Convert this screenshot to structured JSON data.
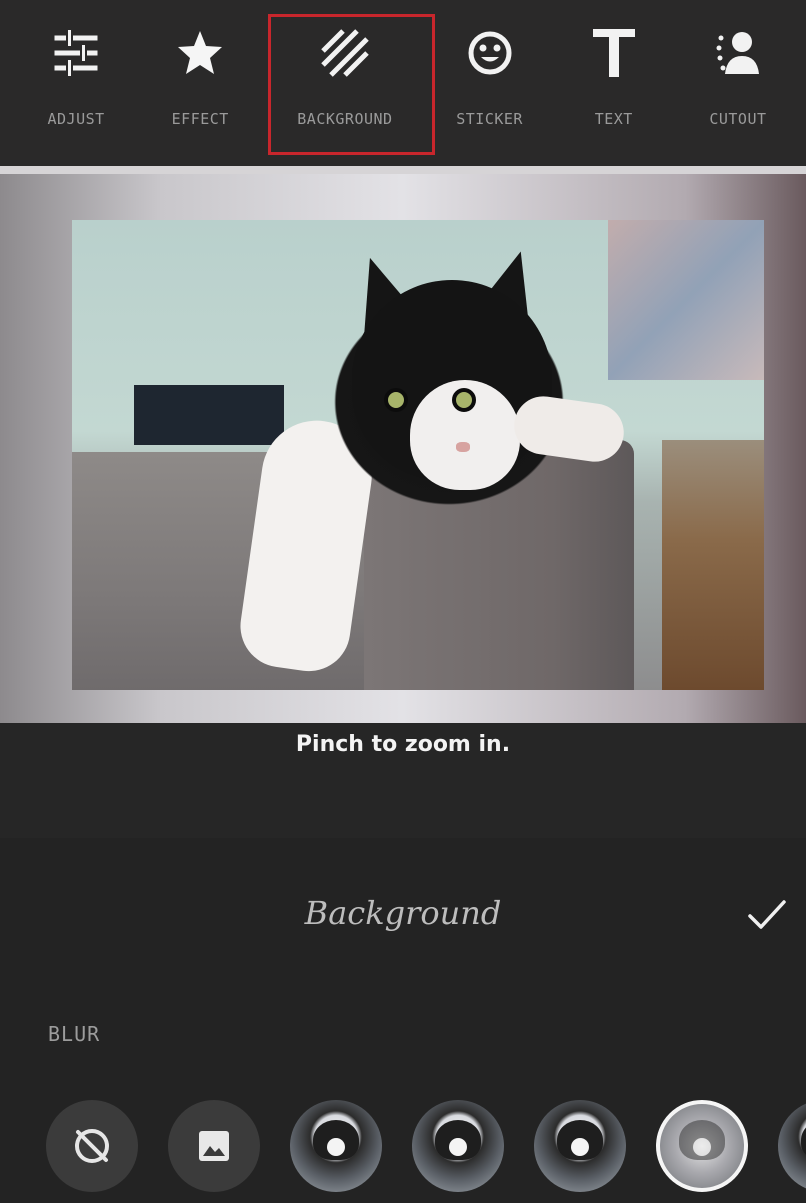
{
  "toolbar": {
    "items": [
      {
        "label": "ADJUST",
        "icon": "sliders-icon"
      },
      {
        "label": "EFFECT",
        "icon": "star-icon"
      },
      {
        "label": "BACKGROUND",
        "icon": "diagonal-stripes-icon",
        "selected": true
      },
      {
        "label": "STICKER",
        "icon": "smiley-icon"
      },
      {
        "label": "TEXT",
        "icon": "text-icon"
      },
      {
        "label": "CUTOUT",
        "icon": "person-cutout-icon"
      }
    ],
    "highlight_color": "#c8262c"
  },
  "canvas": {
    "hint": "Pinch to zoom in."
  },
  "panel": {
    "title": "Background",
    "section_label": "BLUR",
    "options": [
      {
        "kind": "none",
        "icon": "no-blur-icon"
      },
      {
        "kind": "gallery",
        "icon": "image-icon"
      },
      {
        "kind": "thumbnail"
      },
      {
        "kind": "thumbnail"
      },
      {
        "kind": "thumbnail"
      },
      {
        "kind": "thumbnail",
        "selected": true
      },
      {
        "kind": "thumbnail"
      }
    ]
  }
}
